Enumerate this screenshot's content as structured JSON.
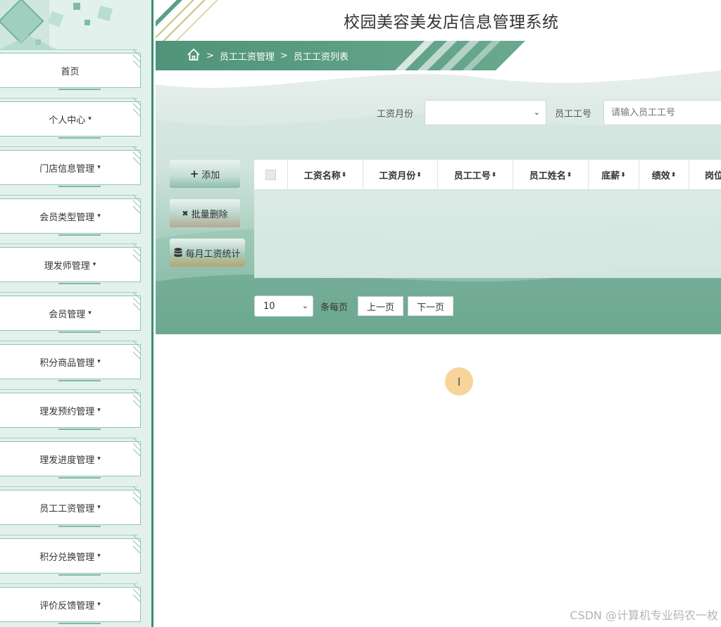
{
  "app": {
    "title": "校园美容美发店信息管理系统"
  },
  "breadcrumb": {
    "sep": ">",
    "items": [
      "员工工资管理",
      "员工工资列表"
    ]
  },
  "sidebar": {
    "items": [
      {
        "label": "首页",
        "caret": ""
      },
      {
        "label": "个人中心",
        "caret": "▾"
      },
      {
        "label": "门店信息管理",
        "caret": "▾"
      },
      {
        "label": "会员类型管理",
        "caret": "▾"
      },
      {
        "label": "理发师管理",
        "caret": "▾"
      },
      {
        "label": "会员管理",
        "caret": "▾"
      },
      {
        "label": "积分商品管理",
        "caret": "▾"
      },
      {
        "label": "理发预约管理",
        "caret": "▾"
      },
      {
        "label": "理发进度管理",
        "caret": "▾"
      },
      {
        "label": "员工工资管理",
        "caret": "▾"
      },
      {
        "label": "积分兑换管理",
        "caret": "▾"
      },
      {
        "label": "评价反馈管理",
        "caret": "▾"
      }
    ]
  },
  "search": {
    "month_label": "工资月份",
    "month_value": "",
    "emp_no_label": "员工工号",
    "emp_no_placeholder": "请输入员工工号"
  },
  "actions": {
    "add": {
      "icon": "+",
      "label": "添加"
    },
    "batch_delete": {
      "icon": "✖",
      "label": "批量删除"
    },
    "monthly_stats": {
      "icon": "database-icon",
      "label": "每月工资统计"
    }
  },
  "table": {
    "sort_glyph": "⬍",
    "headers": [
      "工资名称",
      "工资月份",
      "员工工号",
      "员工姓名",
      "底薪",
      "绩效",
      "岗位"
    ]
  },
  "pagination": {
    "page_size": "10",
    "per_page_label": "条每页",
    "prev": "上一页",
    "next": "下一页"
  },
  "cursor": {
    "glyph": "I"
  },
  "watermark": "CSDN @计算机专业码农一枚",
  "colors": {
    "accent": "#5a9e85",
    "sidebar_bg": "#e3f1ec",
    "border": "#3f8a72"
  }
}
